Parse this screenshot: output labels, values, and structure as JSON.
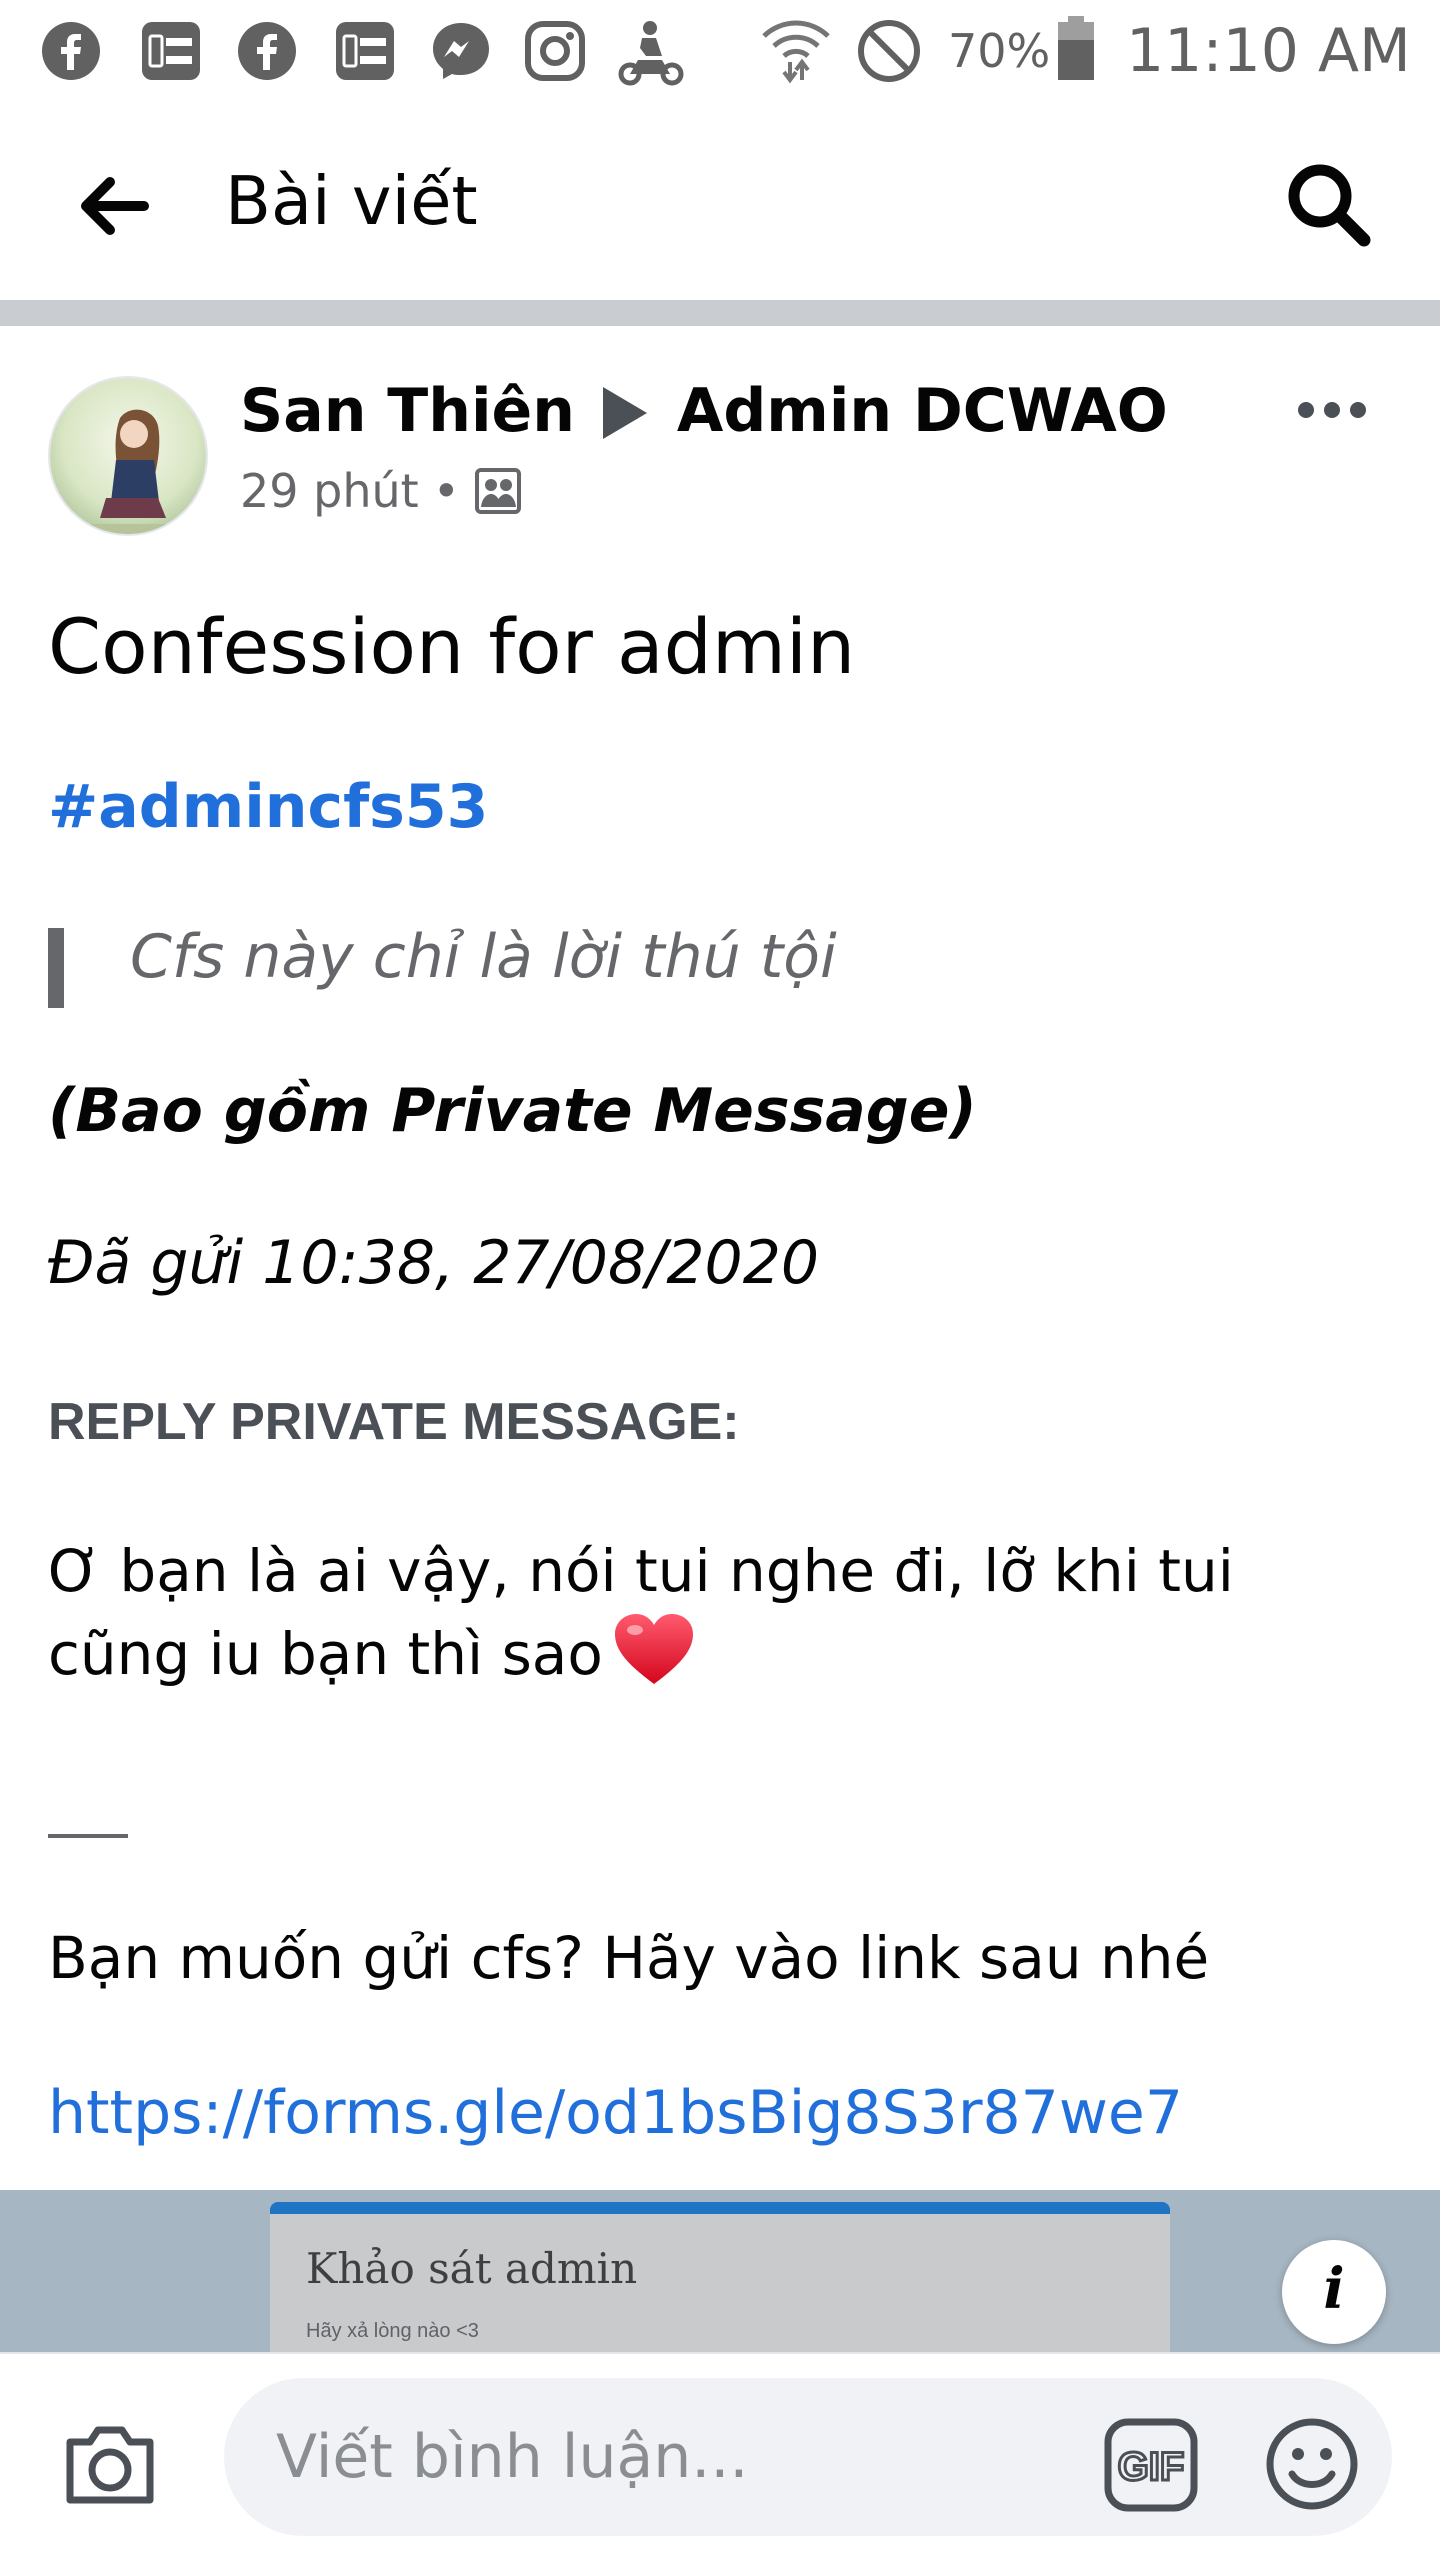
{
  "status_bar": {
    "battery_percent": "70%",
    "time": "11:10 AM",
    "icons": [
      "facebook-icon",
      "baohay-icon",
      "facebook-icon",
      "baohay-icon",
      "messenger-icon",
      "instagram-icon",
      "delivery-icon",
      "wifi-icon",
      "do-not-disturb-icon",
      "battery-icon"
    ]
  },
  "header": {
    "title": "Bài viết"
  },
  "post": {
    "author": "San Thiên",
    "target": "Admin DCWAO",
    "time": "29 phút",
    "title": "Confession for admin",
    "hashtag": "#admincfs53",
    "quote": "Cfs này chỉ là lời thú tội",
    "includes": "(Bao gồm Private Message)",
    "sent": "Đã gửi 10:38, 27/08/2020",
    "reply_heading": "REPLY PRIVATE MESSAGE:",
    "reply_body": "Ơ bạn là ai vậy, nói tui nghe đi, lỡ khi tui cũng iu bạn thì sao",
    "divider": "—",
    "cta": "Bạn muốn gửi cfs? Hãy vào link sau nhé",
    "link": "https://forms.gle/od1bsBig8S3r87we7"
  },
  "preview": {
    "title": "Khảo sát admin",
    "subtitle": "Hãy xả lòng nào <3",
    "info_label": "i"
  },
  "comment_bar": {
    "placeholder": "Viết bình luận...",
    "gif_label": "GIF"
  },
  "colors": {
    "link_blue": "#216fdb",
    "divider_gray": "#c9ccd1",
    "heart_red": "#e0245e"
  }
}
